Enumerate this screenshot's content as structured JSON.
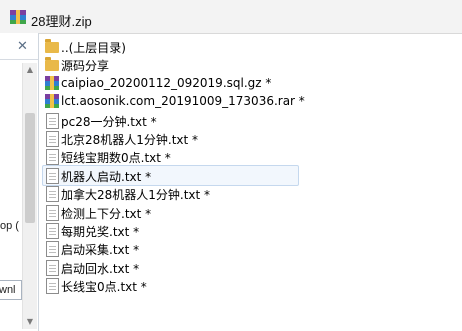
{
  "window": {
    "title": "28理财.zip",
    "title_icon": "winrar-archive-icon"
  },
  "left_pane": {
    "close_label": "✕",
    "snippet_1": "op (",
    "snippet_2": "wnl"
  },
  "files": [
    {
      "name": "..(上层目录)",
      "type": "folder"
    },
    {
      "name": "源码分享",
      "type": "folder"
    },
    {
      "name": "caipiao_20200112_092019.sql.gz *",
      "type": "archive"
    },
    {
      "name": "lct.aosonik.com_20191009_173036.rar *",
      "type": "archive"
    },
    {
      "name": "pc28一分钟.txt *",
      "type": "text"
    },
    {
      "name": "北京28机器人1分钟.txt *",
      "type": "text"
    },
    {
      "name": "短线宝期数0点.txt *",
      "type": "text"
    },
    {
      "name": "机器人启动.txt *",
      "type": "text",
      "selected": true
    },
    {
      "name": "加拿大28机器人1分钟.txt *",
      "type": "text"
    },
    {
      "name": "检测上下分.txt *",
      "type": "text"
    },
    {
      "name": "每期兑奖.txt *",
      "type": "text"
    },
    {
      "name": "启动采集.txt *",
      "type": "text"
    },
    {
      "name": "启动回水.txt *",
      "type": "text"
    },
    {
      "name": "长线宝0点.txt *",
      "type": "text"
    }
  ]
}
